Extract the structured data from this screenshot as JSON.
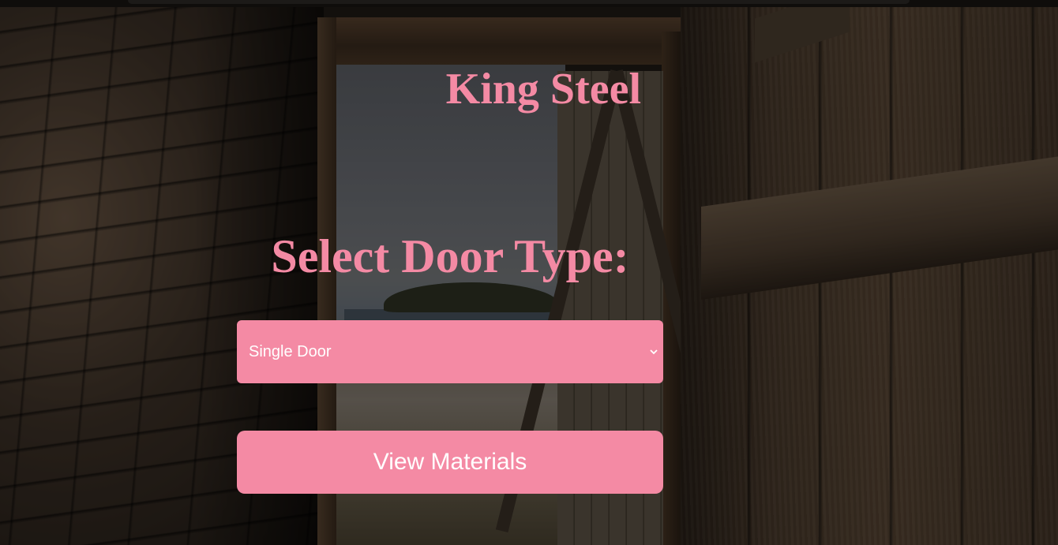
{
  "brand": {
    "title": "King Steel"
  },
  "main": {
    "heading": "Select Door Type:",
    "door_select": {
      "selected": "Single Door"
    },
    "view_button_label": "View Materials"
  },
  "icons": {
    "select_arrow": "chevron-down-icon"
  },
  "colors": {
    "accent": "#f48aa4",
    "text_on_accent": "#ffffff"
  }
}
